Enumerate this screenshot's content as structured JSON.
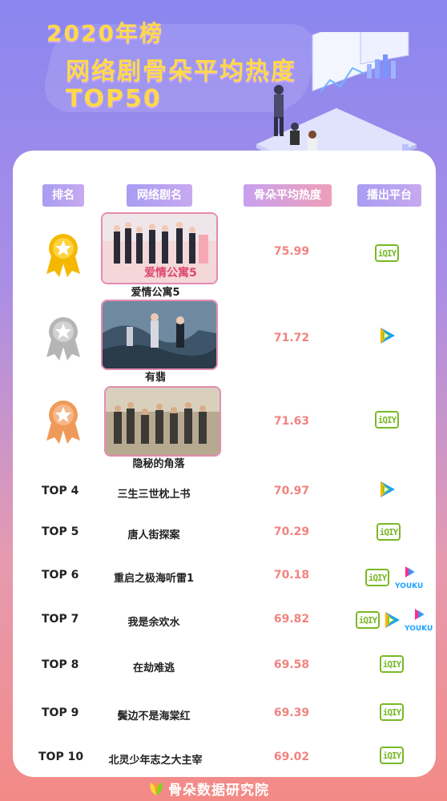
{
  "title": {
    "line1": "2020年榜",
    "line2": "网络剧骨朵平均热度",
    "line3": "TOP50"
  },
  "headers": {
    "rank": "排名",
    "name": "网络剧名",
    "score": "骨朵平均热度",
    "platform": "播出平台"
  },
  "rows": [
    {
      "rank": "",
      "medal": "gold-medal-icon",
      "poster_title": "爱情公寓5",
      "name": "爱情公寓5",
      "score": "75.99",
      "platforms": [
        "iqiyi"
      ]
    },
    {
      "rank": "",
      "medal": "silver-medal-icon",
      "name": "有翡",
      "score": "71.72",
      "platforms": [
        "tencent-video"
      ]
    },
    {
      "rank": "",
      "medal": "bronze-medal-icon",
      "name": "隐秘的角落",
      "score": "71.63",
      "platforms": [
        "iqiyi"
      ]
    },
    {
      "rank": "TOP 4",
      "name": "三生三世枕上书",
      "score": "70.97",
      "platforms": [
        "tencent-video"
      ]
    },
    {
      "rank": "TOP 5",
      "name": "唐人街探案",
      "score": "70.29",
      "platforms": [
        "iqiyi"
      ]
    },
    {
      "rank": "TOP 6",
      "name": "重启之极海听雷1",
      "score": "70.18",
      "platforms": [
        "iqiyi",
        "youku"
      ]
    },
    {
      "rank": "TOP 7",
      "name": "我是余欢水",
      "score": "69.82",
      "platforms": [
        "iqiyi",
        "tencent-video",
        "youku"
      ]
    },
    {
      "rank": "TOP 8",
      "name": "在劫难逃",
      "score": "69.58",
      "platforms": [
        "iqiyi"
      ]
    },
    {
      "rank": "TOP 9",
      "name": "鬓边不是海棠红",
      "score": "69.39",
      "platforms": [
        "iqiyi"
      ]
    },
    {
      "rank": "TOP 10",
      "name": "北灵少年志之大主宰",
      "score": "69.02",
      "platforms": [
        "iqiyi"
      ]
    }
  ],
  "platform_labels": {
    "iqiyi": "iQIY",
    "youku": "YOUKU"
  },
  "footer": {
    "brand": "骨朵数据研究院"
  },
  "colors": {
    "gold": "#f5b800",
    "silver": "#b5b5b5",
    "bronze": "#f09a5a",
    "score": "#f2837f",
    "iqiyi": "#79b827"
  }
}
